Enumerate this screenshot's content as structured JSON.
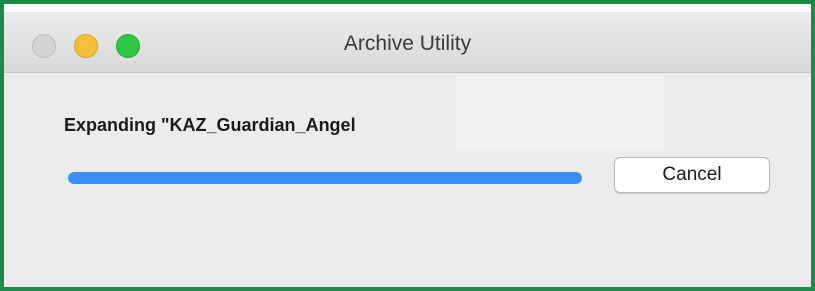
{
  "window": {
    "title": "Archive Utility"
  },
  "window_controls": {
    "close_color": "#d3d3d3",
    "minimize_color": "#f5be3b",
    "zoom_color": "#33c748"
  },
  "status": {
    "text": "Expanding \"KAZ_Guardian_Angel"
  },
  "progress": {
    "percent": 100,
    "color": "#3d8ff3"
  },
  "buttons": {
    "cancel_label": "Cancel"
  },
  "frame": {
    "border_color": "#1e8a47"
  }
}
